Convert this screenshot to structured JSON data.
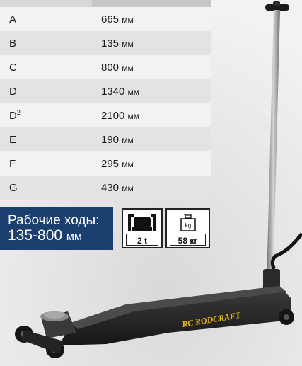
{
  "spec_table": {
    "rows": [
      {
        "key": "A",
        "sup": "",
        "value": "665",
        "unit": "мм"
      },
      {
        "key": "B",
        "sup": "",
        "value": "135",
        "unit": "мм"
      },
      {
        "key": "C",
        "sup": "",
        "value": "800",
        "unit": "мм"
      },
      {
        "key": "D",
        "sup": "",
        "value": "1340",
        "unit": "мм"
      },
      {
        "key": "D",
        "sup": "2",
        "value": "2100",
        "unit": "мм"
      },
      {
        "key": "E",
        "sup": "",
        "value": "190",
        "unit": "мм"
      },
      {
        "key": "F",
        "sup": "",
        "value": "295",
        "unit": "мм"
      },
      {
        "key": "G",
        "sup": "",
        "value": "430",
        "unit": "мм"
      }
    ]
  },
  "stroke": {
    "line1": "Рабочие ходы:",
    "range": "135-800",
    "unit": "мм"
  },
  "capacity_icon": {
    "label": "2 t",
    "icon": "jack-capacity-icon"
  },
  "weight_icon": {
    "label": "58 кг",
    "unit_mark": "kg",
    "icon": "weight-icon"
  },
  "product": {
    "brand": "RC RODCRAFT"
  },
  "colors": {
    "stroke_box": "#1b3f6e",
    "brand_text": "#e7b81f"
  }
}
